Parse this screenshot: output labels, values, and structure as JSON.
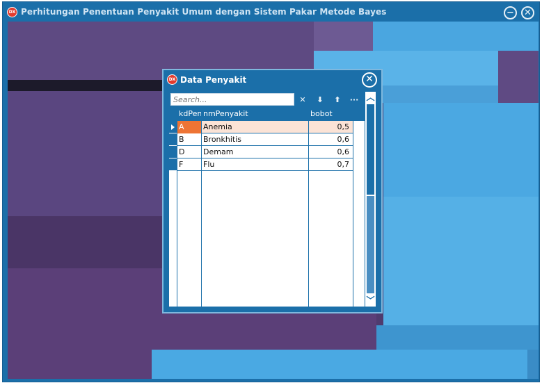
{
  "app": {
    "title": "Perhitungan Penentuan Penyakit Umum dengan Sistem Pakar Metode Bayes",
    "logo_text": "DX",
    "minimize_icon": "minimize-icon",
    "close_icon": "close-icon"
  },
  "dialog": {
    "title": "Data Penyakit",
    "logo_text": "DX",
    "close_icon": "close-icon"
  },
  "search": {
    "placeholder": "Search...",
    "buttons": {
      "clear": "✕",
      "next": "⬇",
      "prev": "⬆",
      "more": "···"
    }
  },
  "grid": {
    "columns": [
      "kdPenyakit",
      "nmPenyakit",
      "bobot"
    ],
    "rows": [
      {
        "kd": "A",
        "nm": "Anemia",
        "bobot": "0,5"
      },
      {
        "kd": "B",
        "nm": "Bronkhitis",
        "bobot": "0,6"
      },
      {
        "kd": "D",
        "nm": "Demam",
        "bobot": "0,6"
      },
      {
        "kd": "F",
        "nm": "Flu",
        "bobot": "0,7"
      }
    ],
    "selected_row": 0
  },
  "colors": {
    "accent": "#1b6fa9",
    "selection": "#ee7434",
    "selection_row": "#fbe3d6"
  }
}
